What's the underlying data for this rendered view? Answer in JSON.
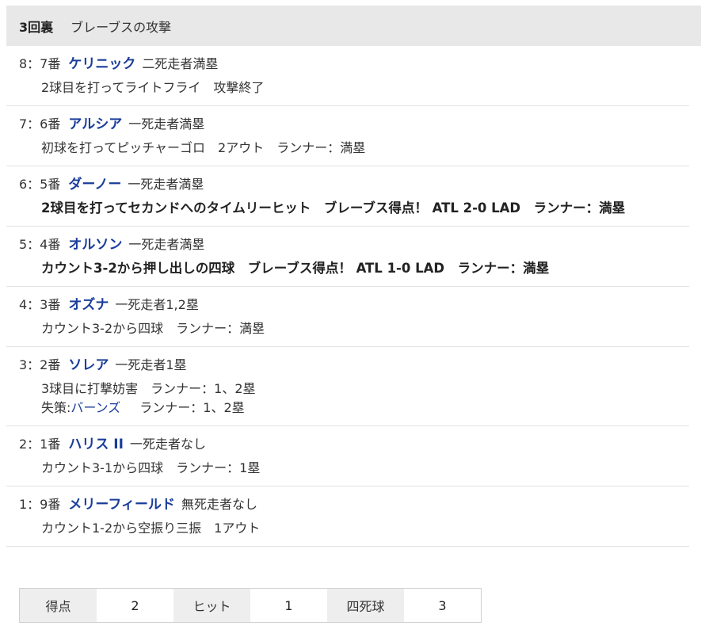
{
  "header": {
    "inning": "3回裏",
    "attack": "ブレーブスの攻撃"
  },
  "plays": [
    {
      "num": "8：7番",
      "batter": "ケリニック",
      "situation": "二死走者満塁",
      "detail": "2球目を打ってライトフライ　攻撃終了",
      "bold": false,
      "extra": null
    },
    {
      "num": "7：6番",
      "batter": "アルシア",
      "situation": "一死走者満塁",
      "detail": "初球を打ってピッチャーゴロ　2アウト　ランナー：満塁",
      "bold": false,
      "extra": null
    },
    {
      "num": "6：5番",
      "batter": "ダーノー",
      "situation": "一死走者満塁",
      "detail": "2球目を打ってセカンドへのタイムリーヒット　ブレーブス得点！ ATL 2-0 LAD　ランナー：満塁",
      "bold": true,
      "extra": null
    },
    {
      "num": "5：4番",
      "batter": "オルソン",
      "situation": "一死走者満塁",
      "detail": "カウント3-2から押し出しの四球　ブレーブス得点！ ATL 1-0 LAD　ランナー：満塁",
      "bold": true,
      "extra": null
    },
    {
      "num": "4：3番",
      "batter": "オズナ",
      "situation": "一死走者1,2塁",
      "detail": "カウント3-2から四球　ランナー：満塁",
      "bold": false,
      "extra": null
    },
    {
      "num": "3：2番",
      "batter": "ソレア",
      "situation": "一死走者1塁",
      "detail": "3球目に打撃妨害　ランナー：1、2塁",
      "bold": false,
      "extra": {
        "prefix": "失策:",
        "player": "バーンズ",
        "runner": "ランナー：1、2塁"
      }
    },
    {
      "num": "2：1番",
      "batter": "ハリス II",
      "situation": "一死走者なし",
      "detail": "カウント3-1から四球　ランナー：1塁",
      "bold": false,
      "extra": null
    },
    {
      "num": "1：9番",
      "batter": "メリーフィールド",
      "situation": "無死走者なし",
      "detail": "カウント1-2から空振り三振　1アウト",
      "bold": false,
      "extra": null
    }
  ],
  "summary": [
    {
      "label": "得点",
      "value": "2"
    },
    {
      "label": "ヒット",
      "value": "1"
    },
    {
      "label": "四死球",
      "value": "3"
    }
  ]
}
